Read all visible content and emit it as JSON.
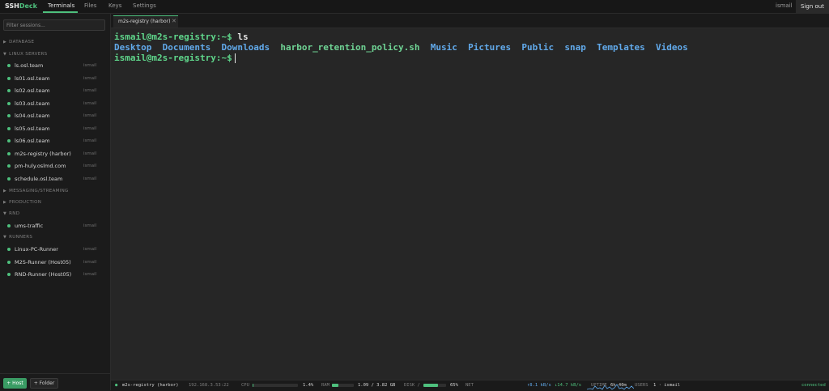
{
  "app": {
    "brand_main": "SSH",
    "brand_accent": "Deck"
  },
  "nav": {
    "tabs": [
      "Terminals",
      "Files",
      "Keys",
      "Settings"
    ],
    "active": "Terminals"
  },
  "header": {
    "user": "ismail",
    "signout_label": "Sign out"
  },
  "sidebar": {
    "filter_placeholder": "Filter sessions...",
    "groups": [
      {
        "label": "DATABASE",
        "arrow": "▶"
      },
      {
        "label": "LINUX SERVERS",
        "arrow": "▼"
      },
      {
        "label": "MESSAGING/STREAMING",
        "arrow": "▶"
      },
      {
        "label": "PRODUCTION",
        "arrow": "▶"
      },
      {
        "label": "RND",
        "arrow": "▼"
      },
      {
        "label": "RUNNERS",
        "arrow": "▼"
      }
    ],
    "hosts": [
      {
        "name": "ls.osl.team",
        "user": "ismail"
      },
      {
        "name": "ls01.osl.team",
        "user": "ismail"
      },
      {
        "name": "ls02.osl.team",
        "user": "ismail"
      },
      {
        "name": "ls03.osl.team",
        "user": "ismail"
      },
      {
        "name": "ls04.osl.team",
        "user": "ismail"
      },
      {
        "name": "ls05.osl.team",
        "user": "ismail"
      },
      {
        "name": "ls06.osl.team",
        "user": "ismail"
      },
      {
        "name": "m2s-registry (harbor)",
        "user": "ismail"
      },
      {
        "name": "pm-huly.oslmd.com",
        "user": "ismail"
      },
      {
        "name": "schedule.osl.team",
        "user": "ismail"
      },
      {
        "name": "ums-traffic",
        "user": "ismail"
      },
      {
        "name": "Linux-PC-Runner",
        "user": "ismail"
      },
      {
        "name": "M2S-Runner (Host05)",
        "user": "ismail"
      },
      {
        "name": "RND-Runner (Host05)",
        "user": "ismail"
      }
    ],
    "add_host_label": "+ Host",
    "add_folder_label": "+ Folder"
  },
  "session_tab": {
    "label": "m2s-registry (harbor)",
    "close": "✕"
  },
  "terminal": {
    "prompt": "ismail@m2s-registry:~$",
    "command": " ls",
    "listing": [
      "Desktop",
      "Documents",
      "Downloads",
      "harbor_retention_policy.sh",
      "Music",
      "Pictures",
      "Public",
      "snap",
      "Templates",
      "Videos"
    ]
  },
  "status": {
    "host": "m2s-registry (harbor)",
    "ip": "192.168.3.53:22",
    "cpu_label": "CPU",
    "cpu_value": "1.4%",
    "cpu_fraction": 0.014,
    "ram_label": "RAM",
    "ram_value": "1.09 / 3.82 GB",
    "ram_fraction": 0.285,
    "disk_label": "DISK /",
    "disk_value": "65%",
    "disk_fraction": 0.65,
    "net_label": "NET",
    "net_down": "↑8.1 kB/s",
    "net_up": "↓14.7 kB/s",
    "uptime_label": "UPTIME",
    "uptime_value": "6h 40m",
    "users_label": "USERS",
    "users_value": "1 · ismail",
    "connection": "connected",
    "colors": {
      "accent": "#4ec07d",
      "net": "#61a9ea"
    }
  }
}
